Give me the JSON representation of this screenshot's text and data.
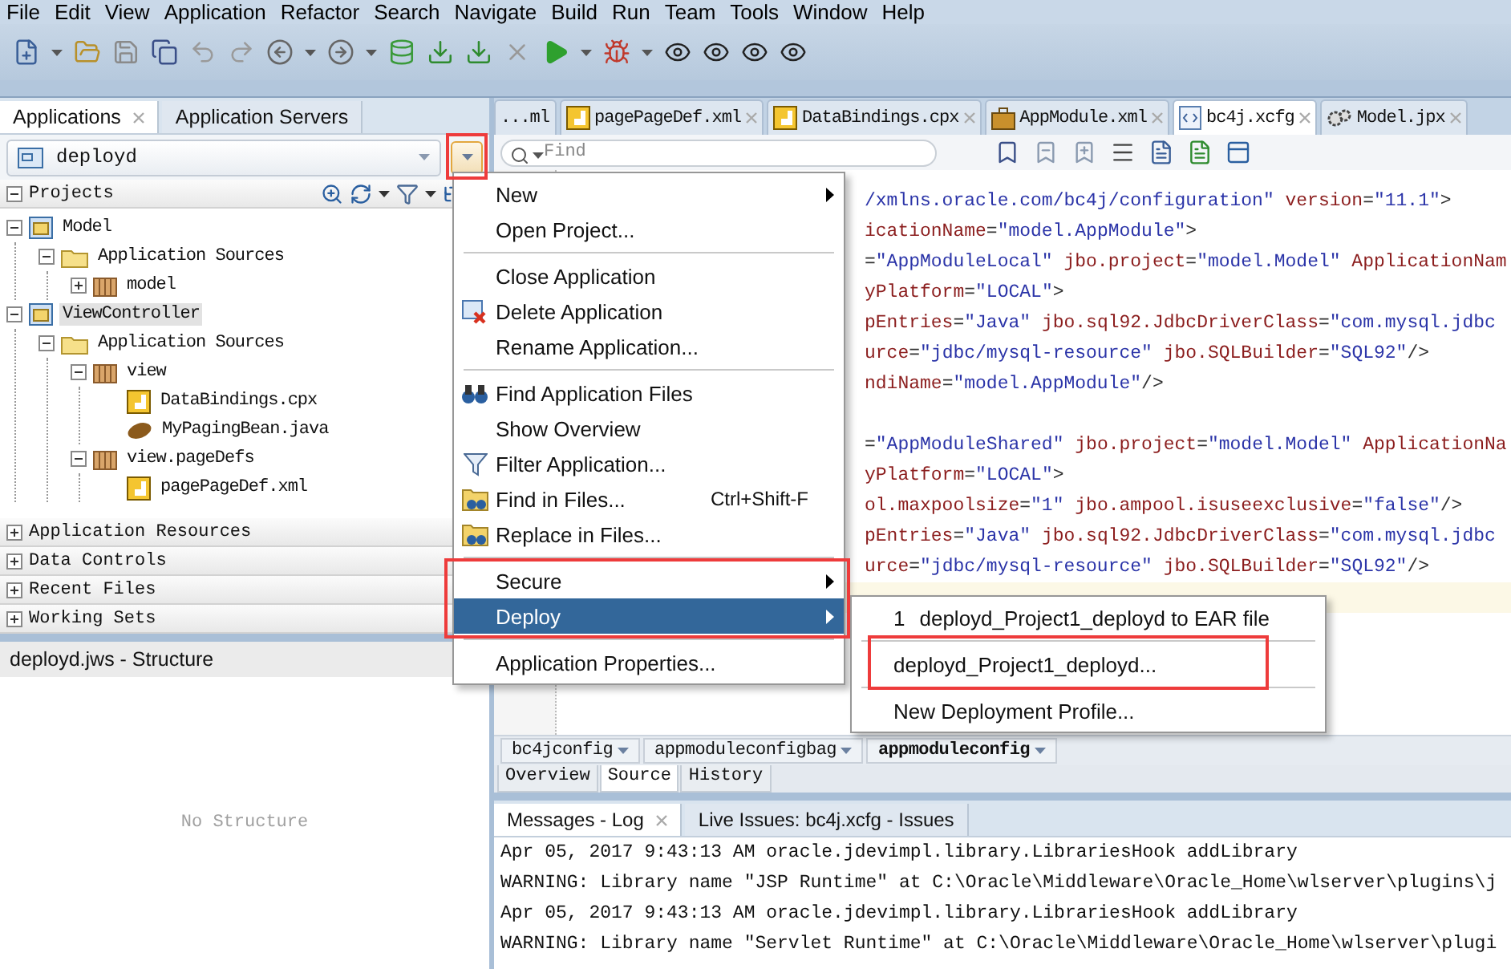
{
  "menu_bar": [
    "File",
    "Edit",
    "View",
    "Application",
    "Refactor",
    "Search",
    "Navigate",
    "Build",
    "Run",
    "Team",
    "Tools",
    "Window",
    "Help"
  ],
  "left_panel": {
    "tabs": [
      {
        "label": "Applications",
        "selected": true
      },
      {
        "label": "Application Servers",
        "selected": false
      }
    ],
    "app_selector": {
      "value": "deployd"
    },
    "projects": {
      "title": "Projects",
      "expanded": true,
      "tree": [
        {
          "label": "Model",
          "kind": "project",
          "expanded": true,
          "selected": false,
          "children": [
            {
              "label": "Application Sources",
              "kind": "folder",
              "expanded": true,
              "selected": false,
              "children": [
                {
                  "label": "model",
                  "kind": "package",
                  "expanded": false,
                  "selected": false
                }
              ]
            }
          ]
        },
        {
          "label": "ViewController",
          "kind": "project",
          "expanded": true,
          "selected": true,
          "children": [
            {
              "label": "Application Sources",
              "kind": "folder",
              "expanded": true,
              "selected": false,
              "children": [
                {
                  "label": "view",
                  "kind": "package",
                  "expanded": true,
                  "selected": false,
                  "children": [
                    {
                      "label": "DataBindings.cpx",
                      "kind": "xml",
                      "selected": false
                    },
                    {
                      "label": "MyPagingBean.java",
                      "kind": "java",
                      "selected": false
                    }
                  ]
                },
                {
                  "label": "view.pageDefs",
                  "kind": "package",
                  "expanded": true,
                  "selected": false,
                  "children": [
                    {
                      "label": "pagePageDef.xml",
                      "kind": "xml",
                      "selected": false
                    }
                  ]
                }
              ]
            }
          ]
        }
      ]
    },
    "sections": [
      {
        "label": "Application Resources",
        "expanded": false
      },
      {
        "label": "Data Controls",
        "expanded": false
      },
      {
        "label": "Recent Files",
        "expanded": false
      },
      {
        "label": "Working Sets",
        "expanded": false
      }
    ]
  },
  "structure_panel": {
    "title": "deployd.jws - Structure",
    "empty_text": "No Structure"
  },
  "editor": {
    "tabs": [
      {
        "label": "...ml",
        "kind": "plain",
        "selected": false
      },
      {
        "label": "pagePageDef.xml",
        "kind": "xml",
        "selected": false
      },
      {
        "label": "DataBindings.cpx",
        "kind": "xml",
        "selected": false
      },
      {
        "label": "AppModule.xml",
        "kind": "module",
        "selected": false
      },
      {
        "label": "bc4j.xcfg",
        "kind": "config",
        "selected": true
      },
      {
        "label": "Model.jpx",
        "kind": "gears",
        "selected": false
      }
    ],
    "find": {
      "placeholder": "Find"
    },
    "code_lines": [
      {
        "kind": "string_tail",
        "text": "/xmlns.oracle.com/bc4j/configuration\" version=\"11.1\">",
        "highlighted": false
      },
      {
        "kind": "code",
        "text": "icationName=\"model.AppModule\">",
        "highlighted": false
      },
      {
        "kind": "code",
        "text": "=\"AppModuleLocal\" jbo.project=\"model.Model\" ApplicationNam",
        "highlighted": false
      },
      {
        "kind": "code",
        "text": "yPlatform=\"LOCAL\">",
        "highlighted": false
      },
      {
        "kind": "code",
        "text": "pEntries=\"Java\" jbo.sql92.JdbcDriverClass=\"com.mysql.jdbc",
        "highlighted": false
      },
      {
        "kind": "code",
        "text": "urce=\"jdbc/mysql-resource\" jbo.SQLBuilder=\"SQL92\"/>",
        "highlighted": false
      },
      {
        "kind": "code",
        "text": "ndiName=\"model.AppModule\"/>",
        "highlighted": false
      },
      {
        "kind": "blank",
        "highlighted": false
      },
      {
        "kind": "code",
        "text": "=\"AppModuleShared\" jbo.project=\"model.Model\" ApplicationNa",
        "highlighted": false
      },
      {
        "kind": "code",
        "text": "yPlatform=\"LOCAL\">",
        "highlighted": false
      },
      {
        "kind": "code",
        "text": "ol.maxpoolsize=\"1\" jbo.ampool.isuseexclusive=\"false\"/>",
        "highlighted": false
      },
      {
        "kind": "code",
        "text": "pEntries=\"Java\" jbo.sql92.JdbcDriverClass=\"com.mysql.jdbc",
        "highlighted": false
      },
      {
        "kind": "code",
        "text": "urce=\"jdbc/mysql-resource\" jbo.SQLBuilder=\"SQL92\"/>",
        "highlighted": false
      },
      {
        "kind": "blank",
        "highlighted": true
      }
    ],
    "breadcrumb": [
      {
        "label": "bc4jconfig",
        "current": false
      },
      {
        "label": "appmoduleconfigbag",
        "current": false
      },
      {
        "label": "appmoduleconfig",
        "current": true
      }
    ],
    "view_tabs": [
      {
        "label": "Overview",
        "selected": false
      },
      {
        "label": "Source",
        "selected": true
      },
      {
        "label": "History",
        "selected": false
      }
    ]
  },
  "log_panel": {
    "tabs": [
      {
        "label": "Messages - Log",
        "selected": true
      },
      {
        "label": "Live Issues: bc4j.xcfg - Issues",
        "selected": false
      }
    ],
    "lines": [
      "Apr 05, 2017 9:43:13 AM oracle.jdevimpl.library.LibrariesHook addLibrary",
      "WARNING: Library name \"JSP Runtime\" at C:\\Oracle\\Middleware\\Oracle_Home\\wlserver\\plugins\\j",
      "Apr 05, 2017 9:43:13 AM oracle.jdevimpl.library.LibrariesHook addLibrary",
      "WARNING: Library name \"Servlet Runtime\" at C:\\Oracle\\Middleware\\Oracle_Home\\wlserver\\plugi"
    ]
  },
  "context_menu": {
    "items": [
      {
        "kind": "plain",
        "label": "New",
        "submenu": true,
        "selected": false
      },
      {
        "kind": "plain",
        "label": "Open Project...",
        "submenu": false,
        "selected": false
      },
      {
        "kind": "separator"
      },
      {
        "kind": "plain",
        "label": "Close Application",
        "submenu": false,
        "selected": false
      },
      {
        "kind": "delete",
        "label": "Delete Application",
        "submenu": false,
        "selected": false
      },
      {
        "kind": "plain",
        "label": "Rename Application...",
        "submenu": false,
        "selected": false
      },
      {
        "kind": "separator"
      },
      {
        "kind": "find",
        "label": "Find Application Files",
        "submenu": false,
        "selected": false
      },
      {
        "kind": "plain",
        "label": "Show Overview",
        "submenu": false,
        "selected": false
      },
      {
        "kind": "filter",
        "label": "Filter Application...",
        "submenu": false,
        "selected": false
      },
      {
        "kind": "find_files",
        "label": "Find in Files...",
        "submenu": false,
        "selected": false,
        "shortcut": "Ctrl+Shift-F"
      },
      {
        "kind": "find_files",
        "label": "Replace in Files...",
        "submenu": false,
        "selected": false
      },
      {
        "kind": "separator"
      },
      {
        "kind": "plain",
        "label": "Secure",
        "submenu": true,
        "selected": false
      },
      {
        "kind": "plain",
        "label": "Deploy",
        "submenu": true,
        "selected": true
      },
      {
        "kind": "separator"
      },
      {
        "kind": "plain",
        "label": "Application Properties...",
        "submenu": false,
        "selected": false
      }
    ]
  },
  "submenu": {
    "items": [
      {
        "kind": "item",
        "number": "1",
        "label": "deployd_Project1_deployd to EAR file"
      },
      {
        "kind": "separator"
      },
      {
        "kind": "item",
        "label": "deployd_Project1_deployd..."
      },
      {
        "kind": "separator"
      },
      {
        "kind": "item",
        "label": "New Deployment Profile..."
      }
    ]
  }
}
